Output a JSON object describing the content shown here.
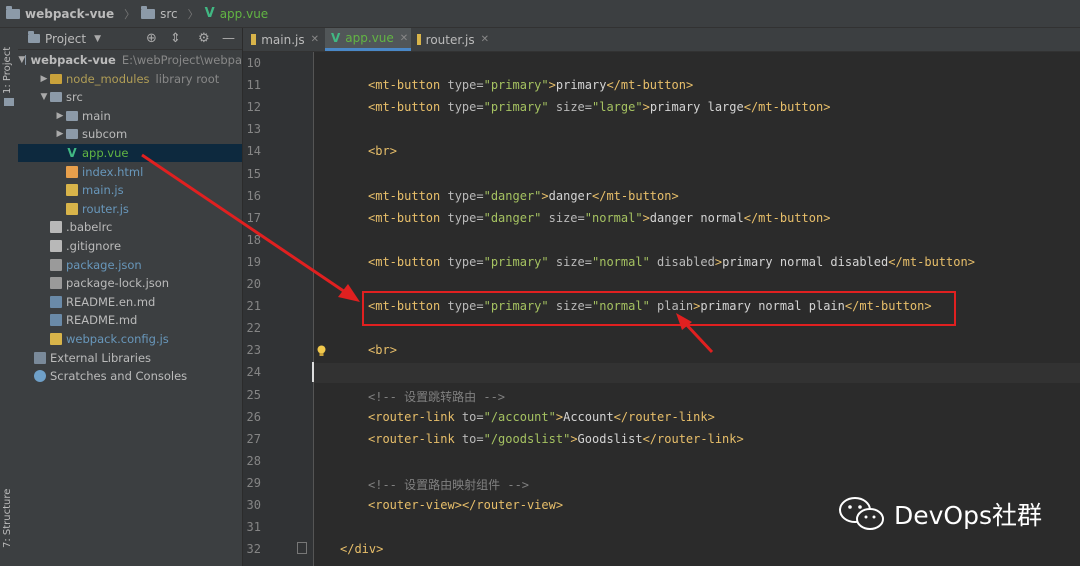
{
  "breadcrumbs": [
    "webpack-vue",
    "src",
    "app.vue"
  ],
  "tool_stripe": {
    "project_tab": "1: Project",
    "structure_tab": "7: Structure"
  },
  "project_panel": {
    "title": "Project",
    "tree": [
      {
        "label": "webpack-vue",
        "extra": "E:\\webProject\\webpa",
        "icon": "folder-icon",
        "depth": 0,
        "arrow": "▼"
      },
      {
        "label": "node_modules",
        "extra": "library root",
        "icon": "folder-icon",
        "depth": 1,
        "arrow": "▶"
      },
      {
        "label": "src",
        "extra": "",
        "icon": "folder-icon",
        "depth": 1,
        "arrow": "▼"
      },
      {
        "label": "main",
        "extra": "",
        "icon": "folder-icon",
        "depth": 2,
        "arrow": "▶"
      },
      {
        "label": "subcom",
        "extra": "",
        "icon": "folder-icon",
        "depth": 2,
        "arrow": "▶"
      },
      {
        "label": "app.vue",
        "extra": "",
        "icon": "vue-file-icon",
        "depth": 2,
        "arrow": ""
      },
      {
        "label": "index.html",
        "extra": "",
        "icon": "html-file-icon",
        "depth": 2,
        "arrow": ""
      },
      {
        "label": "main.js",
        "extra": "",
        "icon": "js-file-icon",
        "depth": 2,
        "arrow": ""
      },
      {
        "label": "router.js",
        "extra": "",
        "icon": "js-file-icon",
        "depth": 2,
        "arrow": ""
      },
      {
        "label": ".babelrc",
        "extra": "",
        "icon": "config-file-icon",
        "depth": 1,
        "arrow": ""
      },
      {
        "label": ".gitignore",
        "extra": "",
        "icon": "text-file-icon",
        "depth": 1,
        "arrow": ""
      },
      {
        "label": "package.json",
        "extra": "",
        "icon": "json-file-icon",
        "depth": 1,
        "arrow": ""
      },
      {
        "label": "package-lock.json",
        "extra": "",
        "icon": "json-file-icon",
        "depth": 1,
        "arrow": ""
      },
      {
        "label": "README.en.md",
        "extra": "",
        "icon": "markdown-file-icon",
        "depth": 1,
        "arrow": ""
      },
      {
        "label": "README.md",
        "extra": "",
        "icon": "markdown-file-icon",
        "depth": 1,
        "arrow": ""
      },
      {
        "label": "webpack.config.js",
        "extra": "",
        "icon": "js-file-icon",
        "depth": 1,
        "arrow": ""
      },
      {
        "label": "External Libraries",
        "extra": "",
        "icon": "library-icon",
        "depth": 0,
        "arrow": ""
      },
      {
        "label": "Scratches and Consoles",
        "extra": "",
        "icon": "scratches-icon",
        "depth": 0,
        "arrow": ""
      }
    ]
  },
  "tabs": [
    {
      "label": "main.js",
      "active": false
    },
    {
      "label": "app.vue",
      "active": true
    },
    {
      "label": "router.js",
      "active": false
    }
  ],
  "editor": {
    "line_numbers": [
      "10",
      "11",
      "12",
      "13",
      "14",
      "15",
      "16",
      "17",
      "18",
      "19",
      "20",
      "21",
      "22",
      "23",
      "24",
      "25",
      "26",
      "27",
      "28",
      "29",
      "30",
      "31",
      "32"
    ],
    "lines": [
      "",
      "<mt-button type=\"primary\">primary</mt-button>",
      "<mt-button type=\"primary\" size=\"large\">primary large</mt-button>",
      "",
      "<br>",
      "",
      "<mt-button type=\"danger\">danger</mt-button>",
      "<mt-button type=\"danger\" size=\"normal\">danger normal</mt-button>",
      "",
      "<mt-button type=\"primary\" size=\"normal\" disabled>primary normal disabled</mt-button>",
      "",
      "<mt-button type=\"primary\" size=\"normal\" plain>primary normal plain</mt-button>",
      "",
      "<br>",
      "",
      "<!-- 设置跳转路由 -->",
      "<router-link to=\"/account\">Account</router-link>",
      "<router-link to=\"/goodslist\">Goodslist</router-link>",
      "",
      "<!-- 设置路由映射组件 -->",
      "<router-view></router-view>",
      "",
      "</div>"
    ]
  },
  "watermark": {
    "text": "DevOps社群"
  },
  "colors": {
    "highlight_box": "#e02020",
    "arrow": "#e02020",
    "vue_green": "#41b883"
  }
}
